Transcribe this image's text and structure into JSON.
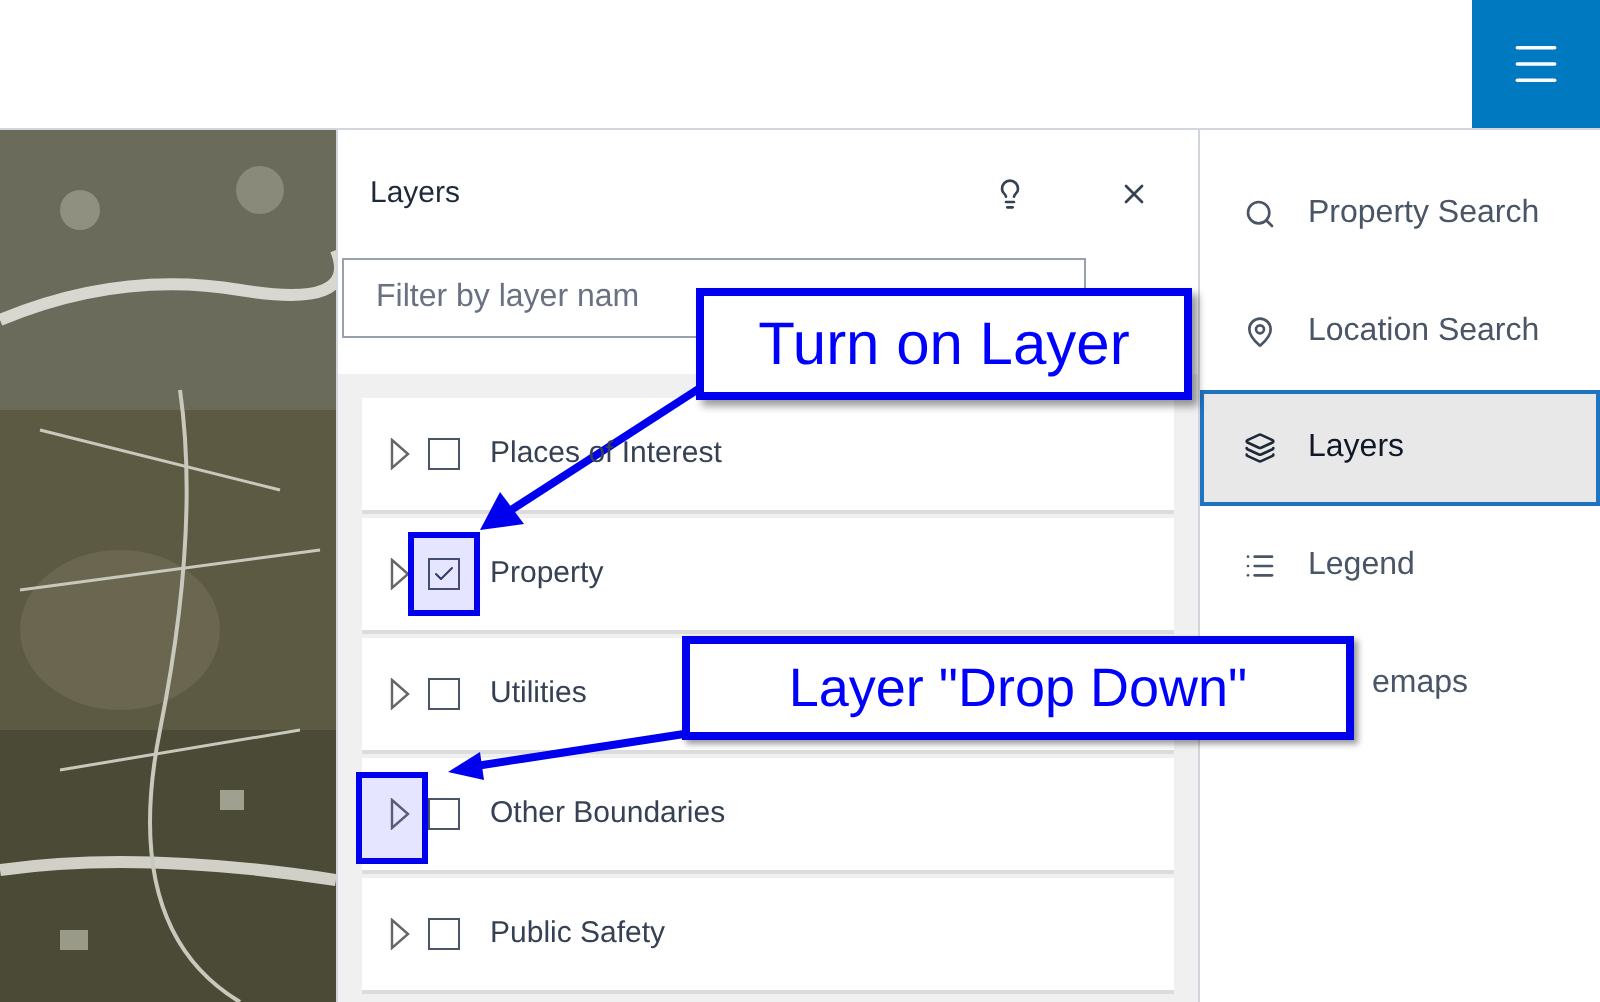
{
  "panel": {
    "title": "Layers",
    "filter": {
      "placeholder": "Filter by layer nam"
    }
  },
  "layers": [
    {
      "name": "Places of Interest",
      "checked": false
    },
    {
      "name": "Property",
      "checked": true
    },
    {
      "name": "Utilities",
      "checked": false
    },
    {
      "name": "Other Boundaries",
      "checked": false
    },
    {
      "name": "Public Safety",
      "checked": false
    }
  ],
  "sidebar": {
    "items": [
      {
        "label": "Property Search",
        "kind": "search",
        "selected": false
      },
      {
        "label": "Location Search",
        "kind": "location",
        "selected": false
      },
      {
        "label": "Layers",
        "kind": "layers",
        "selected": true
      },
      {
        "label": "Legend",
        "kind": "legend",
        "selected": false
      },
      {
        "label": "emaps",
        "kind": "basemaps",
        "selected": false
      }
    ]
  },
  "callouts": [
    {
      "text": "Turn on Layer"
    },
    {
      "text": "Layer \"Drop Down\""
    }
  ]
}
